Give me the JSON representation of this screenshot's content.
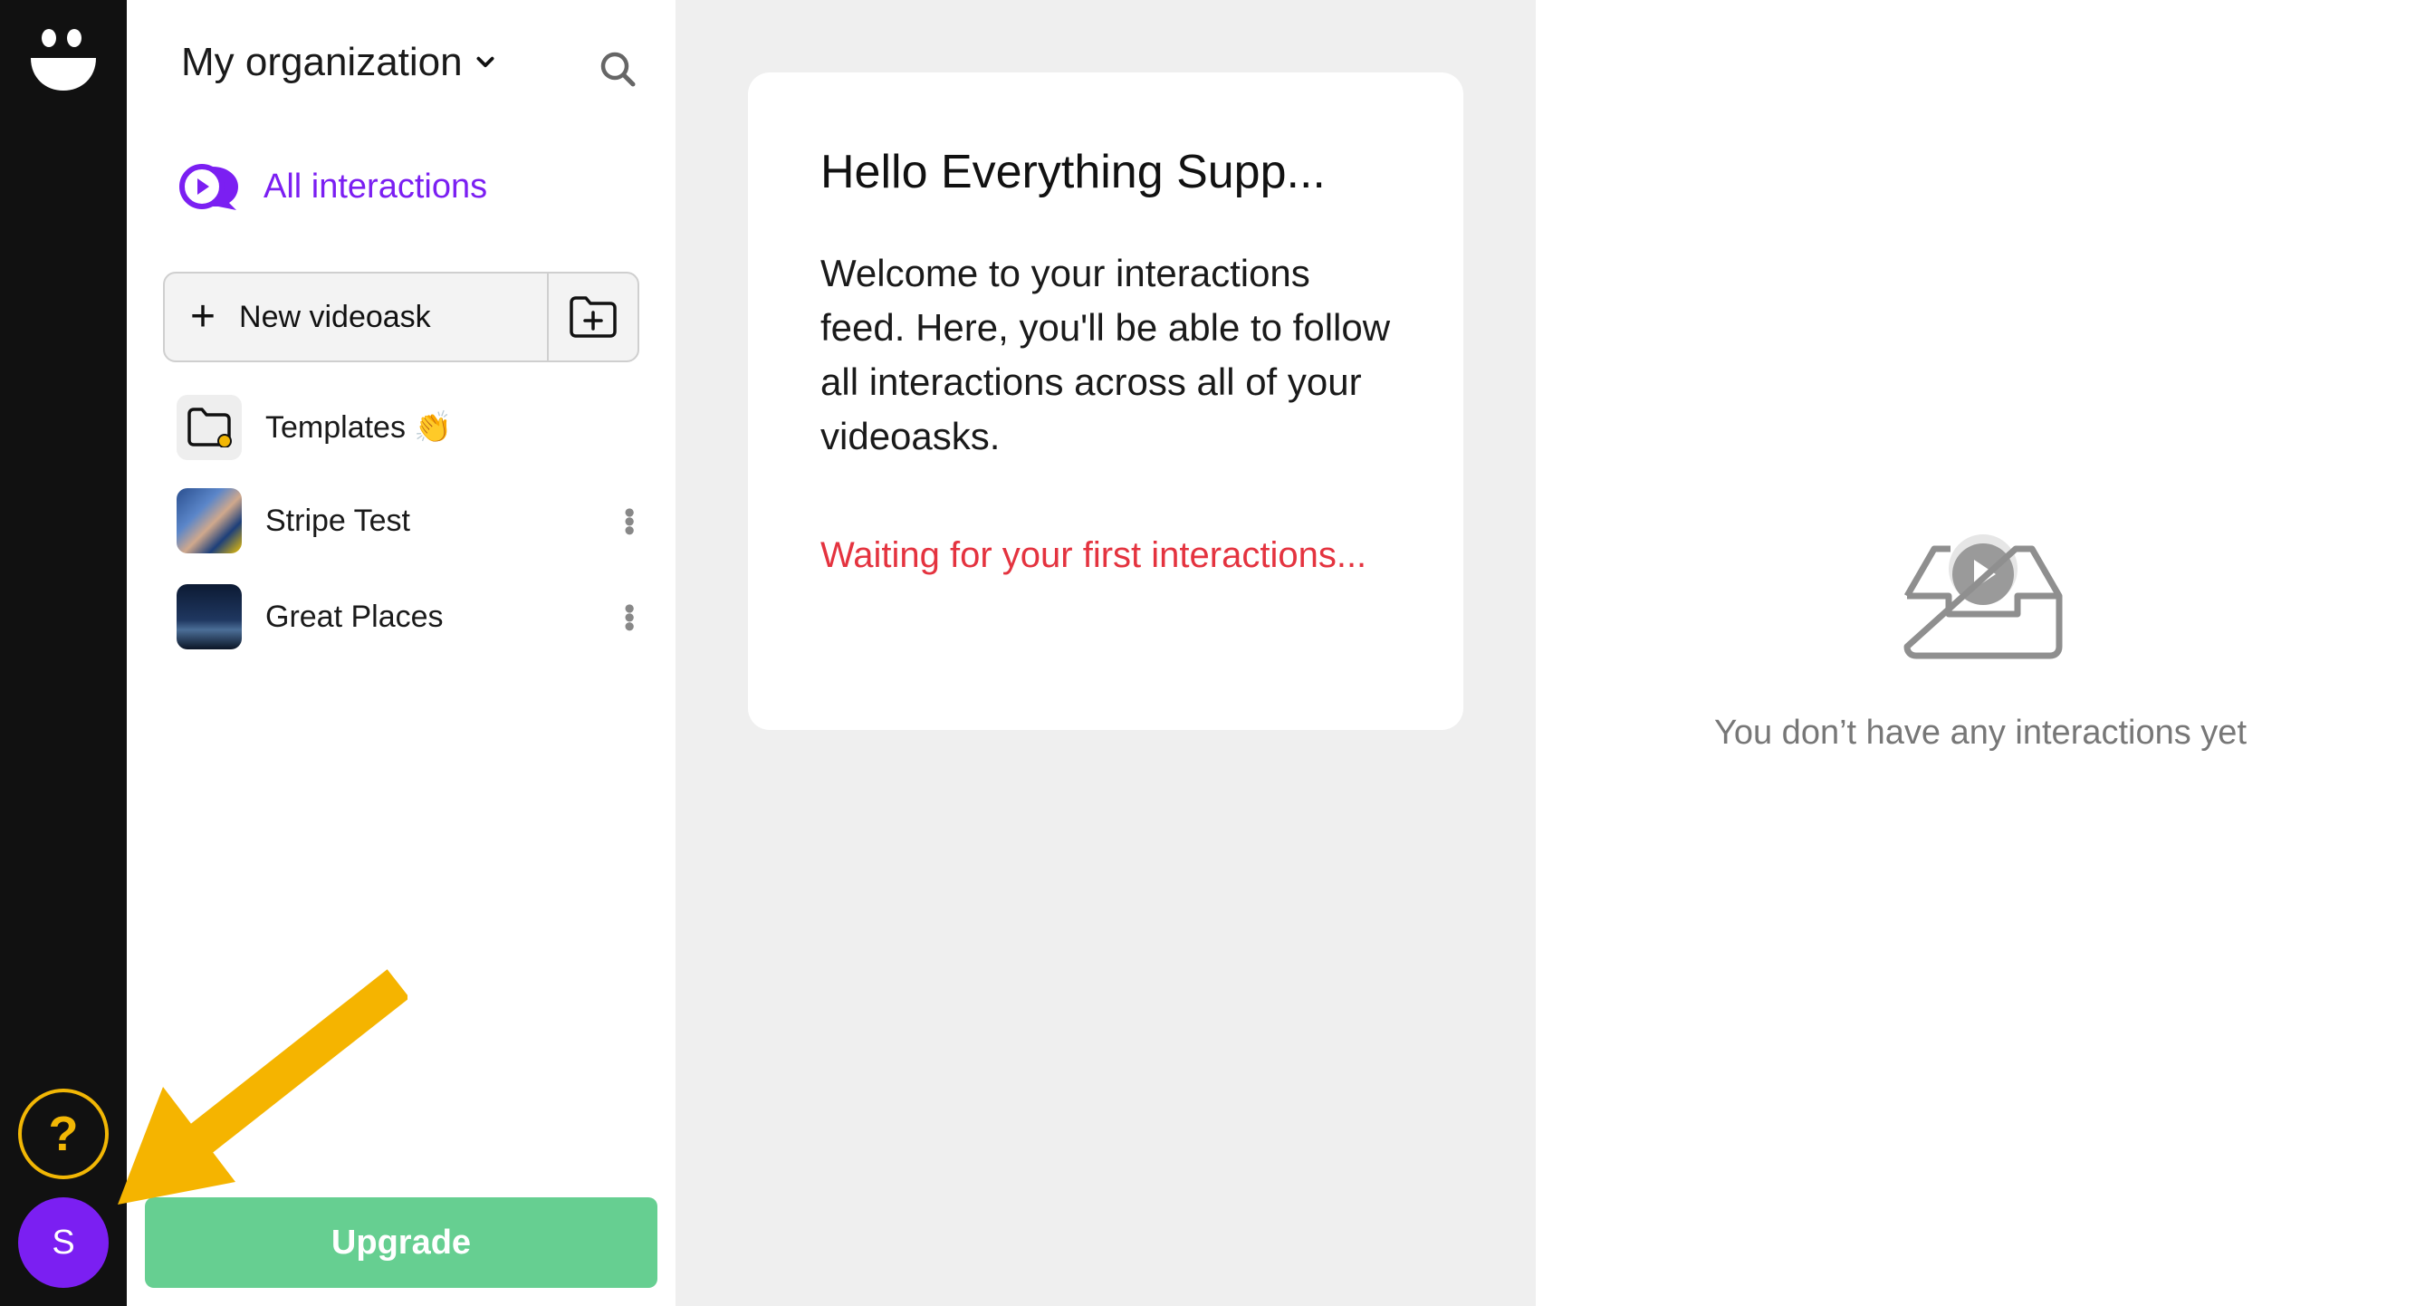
{
  "org": {
    "name": "My organization"
  },
  "nav": {
    "all_interactions": "All interactions"
  },
  "actions": {
    "new_videoask": "New videoask"
  },
  "list": [
    {
      "name": "Templates 👏",
      "icon": "folder-icon"
    },
    {
      "name": "Stripe Test",
      "icon": "thumbnail"
    },
    {
      "name": "Great Places",
      "icon": "thumbnail"
    }
  ],
  "rail": {
    "help": "?",
    "avatar_initial": "S"
  },
  "upgrade": {
    "label": "Upgrade"
  },
  "feed": {
    "title": "Hello Everything Supp...",
    "body": "Welcome to your interactions feed. Here, you'll be able to follow all interactions across all of your videoasks.",
    "waiting": "Waiting for your first interactions..."
  },
  "empty": {
    "text": "You don’t have any interactions yet"
  },
  "colors": {
    "accent": "#7b1ff2",
    "upgrade": "#66cf91",
    "waiting": "#e4333f",
    "help_ring": "#f2b705",
    "arrow": "#f5b400"
  }
}
